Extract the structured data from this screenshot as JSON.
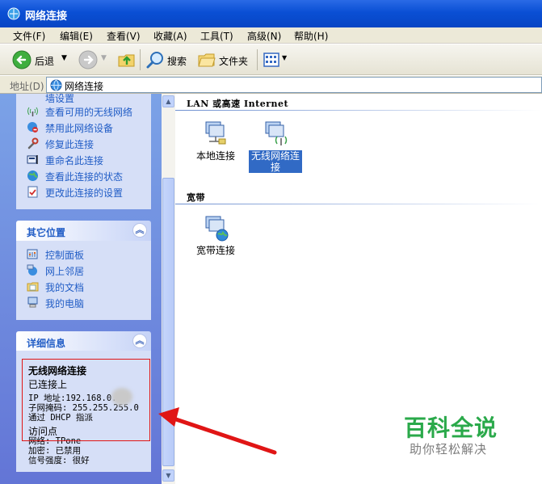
{
  "window": {
    "title": "网络连接"
  },
  "menu": [
    "文件(F)",
    "编辑(E)",
    "查看(V)",
    "收藏(A)",
    "工具(T)",
    "高级(N)",
    "帮助(H)"
  ],
  "toolbar": {
    "back_label": "后退",
    "search_label": "搜索",
    "folders_label": "文件夹"
  },
  "address": {
    "label": "地址(D)",
    "value": "网络连接"
  },
  "tasks": {
    "partial": "墙设置",
    "items": [
      "查看可用的无线网络",
      "禁用此网络设备",
      "修复此连接",
      "重命名此连接",
      "查看此连接的状态",
      "更改此连接的设置"
    ]
  },
  "other_places": {
    "title": "其它位置",
    "items": [
      "控制面板",
      "网上邻居",
      "我的文档",
      "我的电脑"
    ]
  },
  "details": {
    "title": "详细信息",
    "name": "无线网络连接",
    "status": "已连接上",
    "ip": "IP 地址:192.168.0.",
    "mask": "子网掩码: 255.255.255.0",
    "dhcp": "通过 DHCP 指派",
    "ap": "访问点",
    "network": "网络: TPone",
    "encryption": "加密: 已禁用",
    "signal": "信号强度: 很好"
  },
  "groups": {
    "lan_title": "LAN 或高速 Internet",
    "broadband_title": "宽带"
  },
  "connections": {
    "local": "本地连接",
    "wireless_line1": "无线网络连",
    "wireless_line2": "接",
    "broadband": "宽带连接"
  },
  "watermark": {
    "title": "百科全说",
    "subtitle": "助你轻松解决"
  },
  "colors": {
    "title_bar": "#0a4fd4",
    "task_link": "#215dc6",
    "selection": "#316ac5",
    "annotation": "#e01515"
  }
}
